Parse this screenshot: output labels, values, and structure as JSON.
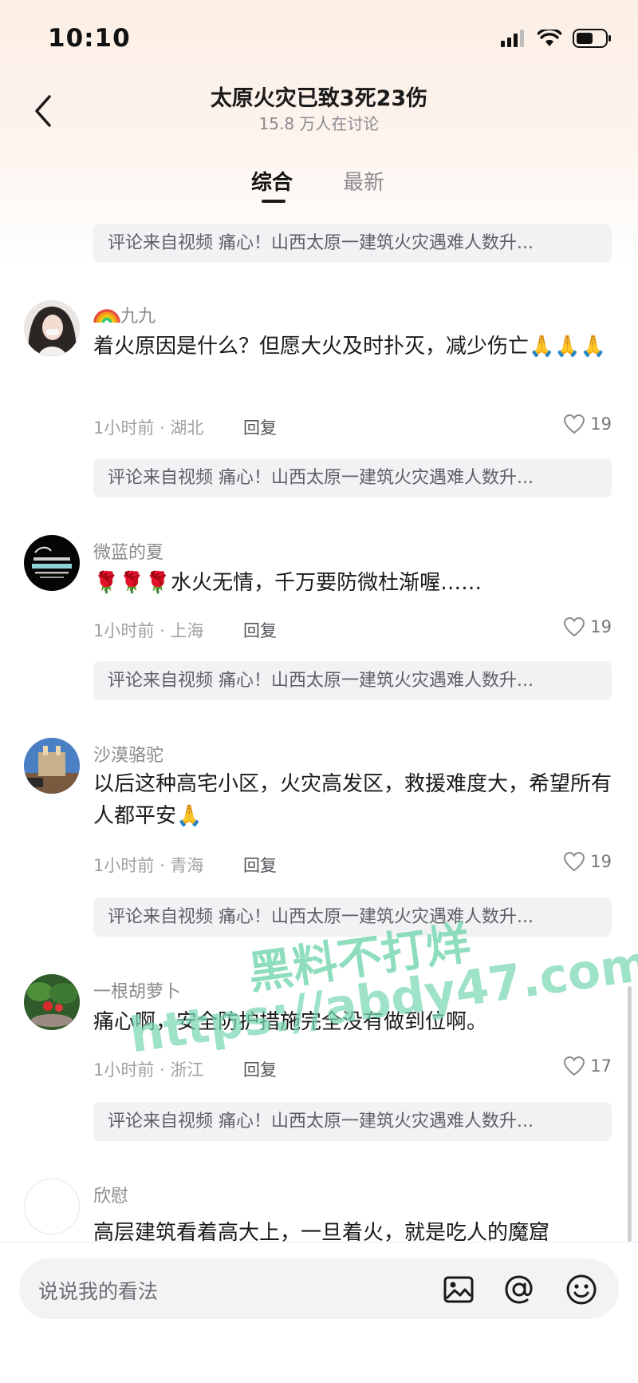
{
  "status_bar": {
    "time": "10:10"
  },
  "header": {
    "title": "太原火灾已致3死23伤",
    "subtitle": "15.8 万人在讨论"
  },
  "tabs": [
    {
      "label": "综合",
      "active": true
    },
    {
      "label": "最新",
      "active": false
    }
  ],
  "video_ref_text": "评论来自视频 痛心！山西太原一建筑火灾遇难人数升...",
  "comments": [
    {
      "username": "九九",
      "username_prefix_icon": "rainbow-emoji",
      "text": "着火原因是什么？但愿大火及时扑灭，减少伤亡🙏🙏🙏",
      "time_loc": "1小时前 · 湖北",
      "reply": "回复",
      "likes": "19"
    },
    {
      "username": "微蓝的夏",
      "text": "🌹🌹🌹水火无情，千万要防微杜渐喔……",
      "time_loc": "1小时前 · 上海",
      "reply": "回复",
      "likes": "19"
    },
    {
      "username": "沙漠骆驼",
      "text": "以后这种高宅小区，火灾高发区，救援难度大，希望所有人都平安🙏",
      "time_loc": "1小时前 · 青海",
      "reply": "回复",
      "likes": "19"
    },
    {
      "username": "一根胡萝卜",
      "text": "痛心啊，安全防护措施完全没有做到位啊。",
      "time_loc": "1小时前 · 浙江",
      "reply": "回复",
      "likes": "17"
    },
    {
      "username": "欣慰",
      "text": "高层建筑看着高大上，一旦着火，就是吃人的魔窟"
    }
  ],
  "watermark": {
    "line1": "黑料不打烊",
    "line2": "https://abdy47.com"
  },
  "bottom_bar": {
    "placeholder": "说说我的看法"
  },
  "icons": {
    "back": "chevron-left-icon",
    "image": "image-icon",
    "mention": "at-icon",
    "emoji": "smiley-icon"
  },
  "colors": {
    "accent_bg": "#fbeee4",
    "watermark": "#6fd6ad"
  }
}
